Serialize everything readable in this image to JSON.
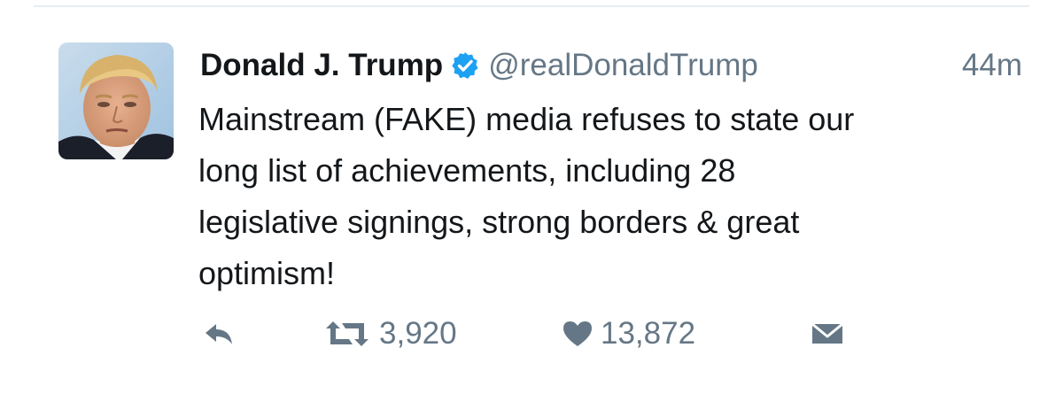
{
  "tweet": {
    "author": {
      "display_name": "Donald J. Trump",
      "handle": "@realDonaldTrump",
      "verified": true
    },
    "timestamp": "44m",
    "text_lines": [
      "Mainstream (FAKE) media refuses to state our",
      "long list of achievements, including 28",
      "legislative signings, strong borders & great",
      "optimism!"
    ],
    "actions": {
      "reply": {
        "icon": "reply-icon"
      },
      "retweet": {
        "icon": "retweet-icon",
        "count": "3,920"
      },
      "like": {
        "icon": "heart-icon",
        "count": "13,872"
      },
      "direct_message": {
        "icon": "envelope-icon"
      }
    }
  },
  "colors": {
    "text": "#14171a",
    "muted": "#657786",
    "verified_badge": "#1da1f2",
    "divider": "#e6ecf0"
  }
}
